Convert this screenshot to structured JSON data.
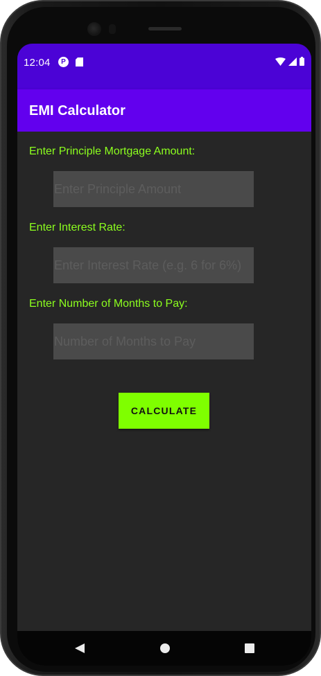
{
  "status_bar": {
    "time": "12:04",
    "icons": [
      "p-icon",
      "sd-card-icon",
      "wifi-icon",
      "signal-icon",
      "battery-icon"
    ]
  },
  "app_bar": {
    "title": "EMI Calculator"
  },
  "form": {
    "principal": {
      "label": "Enter Principle Mortgage Amount:",
      "placeholder": "Enter Principle Amount",
      "value": ""
    },
    "interest": {
      "label": "Enter Interest Rate:",
      "placeholder": "Enter Interest Rate (e.g. 6 for 6%)",
      "value": ""
    },
    "months": {
      "label": "Enter Number of Months to Pay:",
      "placeholder": "Number of Months to Pay",
      "value": ""
    },
    "calculate_label": "CALCULATE"
  },
  "nav_bar": {
    "buttons": [
      "back-icon",
      "home-icon",
      "recents-icon"
    ]
  },
  "colors": {
    "status_bar": "#4b03d6",
    "app_bar": "#6200ee",
    "background": "#262626",
    "accent": "#7fff00",
    "label_text": "#8cff1e",
    "field_bg": "#4a4a4a",
    "placeholder": "#5d5d5d"
  }
}
